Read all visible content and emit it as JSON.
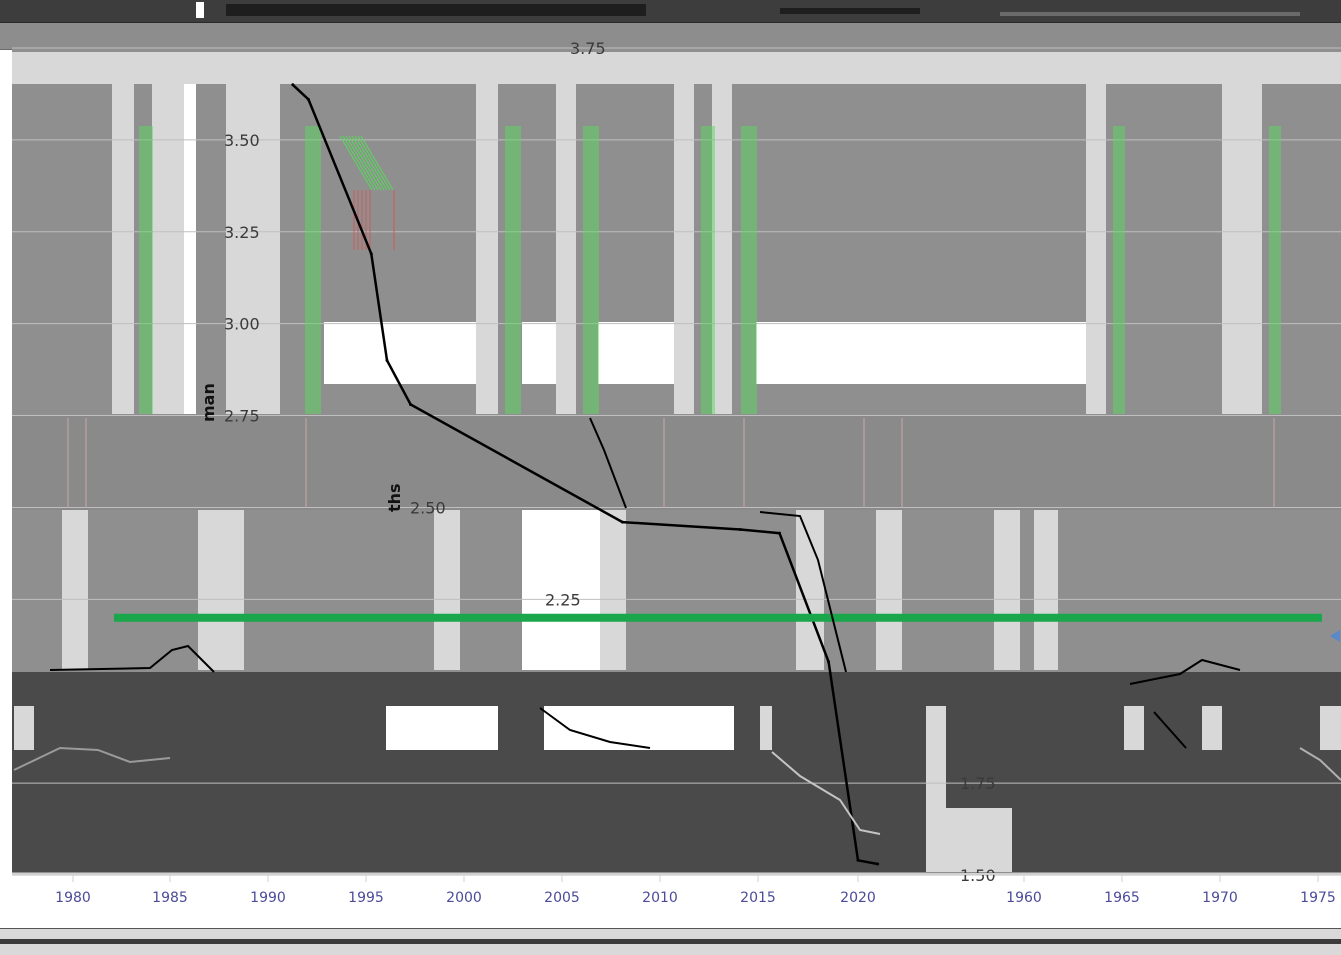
{
  "chart_data": {
    "type": "line",
    "title": "",
    "xlabel": "",
    "ylabel_fragments": [
      "man",
      "ths"
    ],
    "y_tick_labels": [
      "3.75",
      "3.50",
      "3.25",
      "3.00",
      "2.75",
      "2.50",
      "2.25",
      "1.75",
      "1.50"
    ],
    "x_tick_labels_main": [
      "1980",
      "1985",
      "1990",
      "1995",
      "2000",
      "2005",
      "2010",
      "2015",
      "2020"
    ],
    "x_tick_labels_secondary": [
      "1960",
      "1965",
      "1970",
      "1975"
    ],
    "grid": true,
    "series": [
      {
        "color": "#000000",
        "x": [
          1991.2,
          1992.0,
          1995.2,
          1996.0,
          1997.2,
          2008.0,
          2014.0,
          2016.0,
          2018.5,
          2020.0,
          2021.0
        ],
        "y": [
          3.65,
          3.61,
          3.19,
          2.9,
          2.78,
          2.46,
          2.44,
          2.43,
          2.08,
          1.54,
          1.53
        ]
      },
      {
        "color": "#1aa64a",
        "x": [
          1982,
          2025
        ],
        "y": [
          2.2,
          2.2
        ]
      }
    ],
    "colors": {
      "background": "#8f8f8f",
      "gridline": "#bfbfbf",
      "light_band": "#d8d8d8",
      "white_band": "#ffffff",
      "green_ticks": "#58d85c",
      "red_ticks": "#d25a5a",
      "line": "#000000",
      "reference_line": "#1aa64a",
      "lower_panel": "#4a4a4a"
    }
  }
}
